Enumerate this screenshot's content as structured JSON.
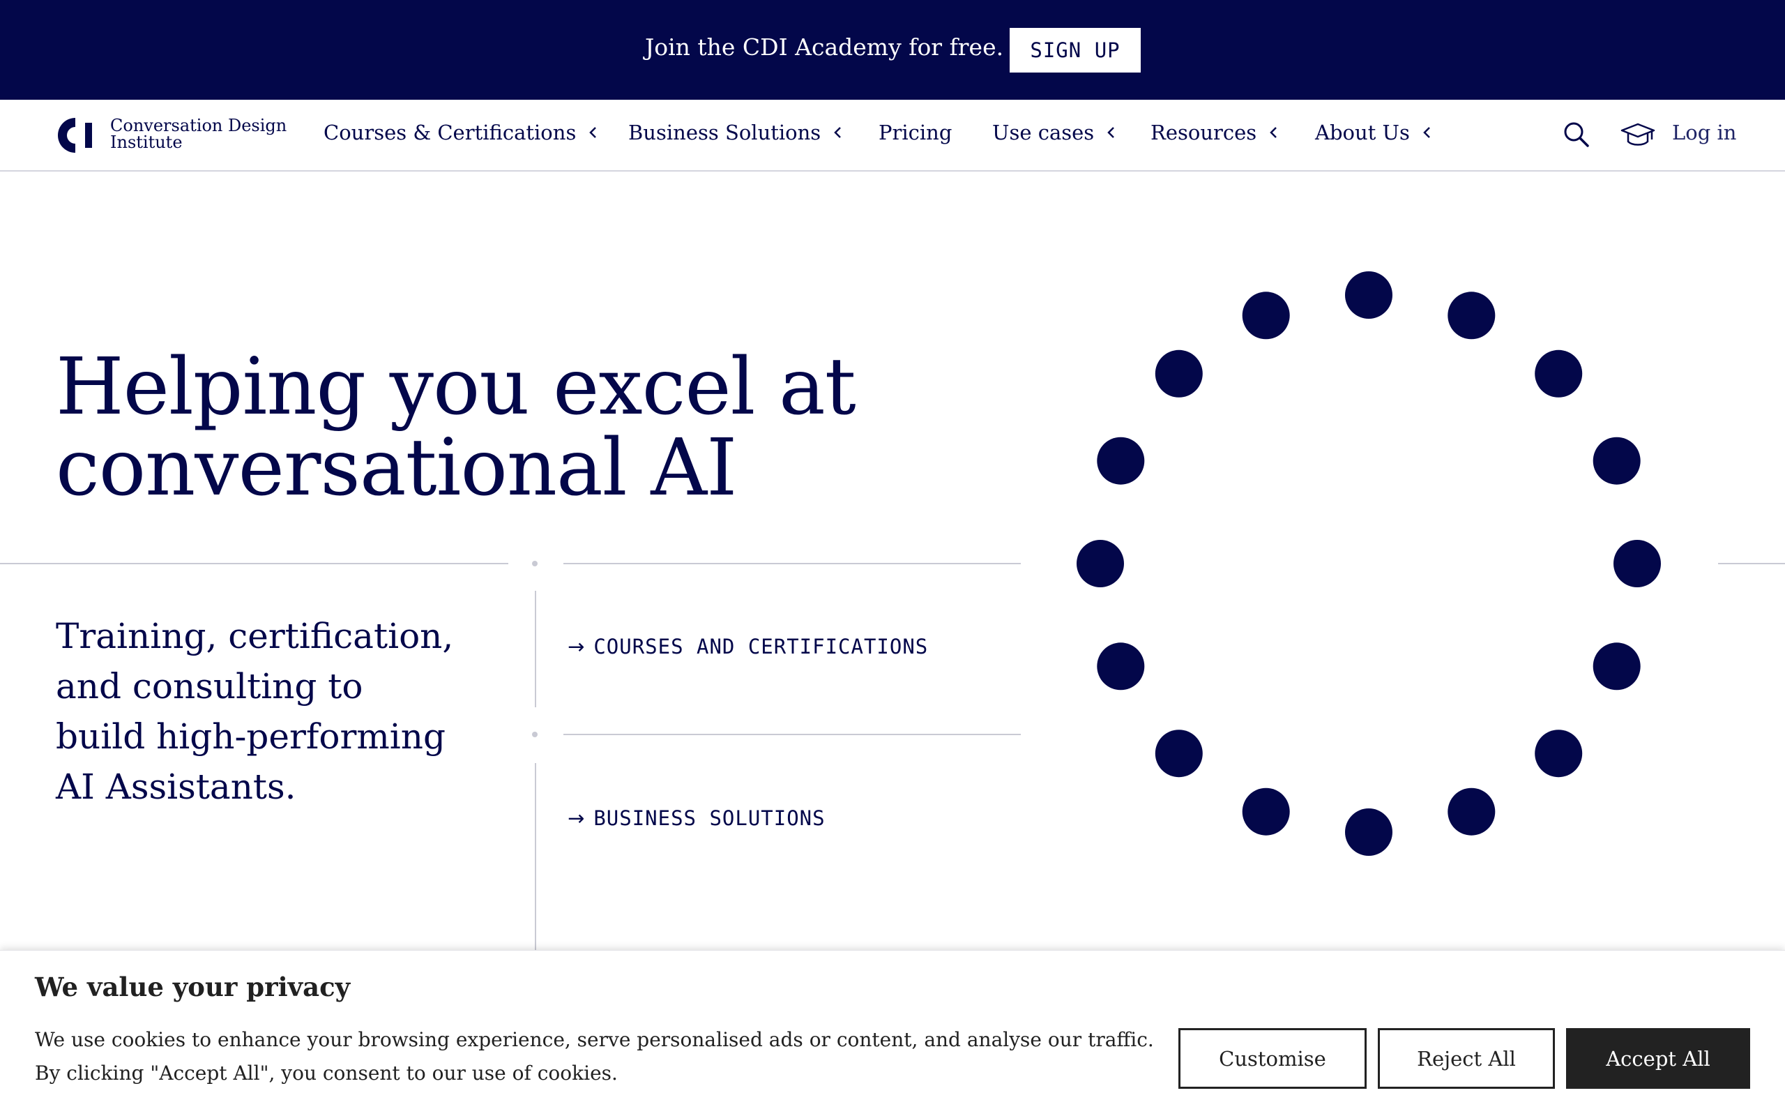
{
  "announcement": {
    "text": "Join the CDI Academy for free.",
    "button_label": "SIGN UP"
  },
  "brand": {
    "name_line1": "Conversation Design",
    "name_line2": "Institute",
    "primary_color": "#03074a"
  },
  "nav": {
    "items": [
      {
        "label": "Courses & Certifications",
        "has_dropdown": true
      },
      {
        "label": "Business Solutions",
        "has_dropdown": true
      },
      {
        "label": "Pricing",
        "has_dropdown": false
      },
      {
        "label": "Use cases",
        "has_dropdown": true
      },
      {
        "label": "Resources",
        "has_dropdown": true
      },
      {
        "label": "About Us",
        "has_dropdown": true
      }
    ],
    "search_icon": "search-icon",
    "account_icon": "graduation-cap-icon",
    "login_label": "Log in"
  },
  "hero": {
    "title_line1": "Helping you excel at",
    "title_line2": "conversational AI",
    "subtitle_lines": [
      "Training, certification,",
      "and consulting to",
      "build high-performing",
      "AI Assistants."
    ],
    "links": [
      {
        "label": "COURSES AND CERTIFICATIONS",
        "icon": "arrow-right-icon"
      },
      {
        "label": "BUSINESS SOLUTIONS",
        "icon": "arrow-right-icon"
      }
    ],
    "illustration": {
      "dot_count": 16,
      "dot_color": "#03074a"
    }
  },
  "cookie_banner": {
    "title": "We value your privacy",
    "text_line1": "We use cookies to enhance your browsing experience, serve personalised ads or content, and analyse our traffic.",
    "text_line2": "By clicking \"Accept All\", you consent to our use of cookies.",
    "customise_label": "Customise",
    "reject_label": "Reject All",
    "accept_label": "Accept All"
  }
}
